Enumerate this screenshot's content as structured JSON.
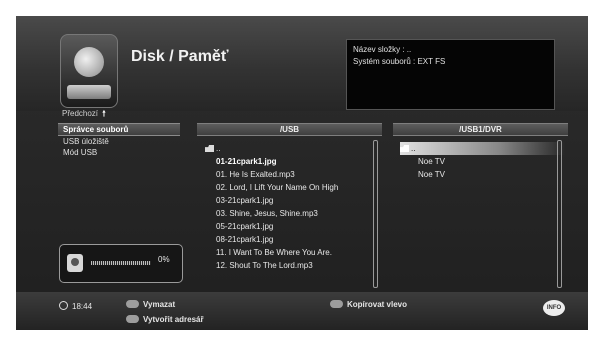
{
  "header": {
    "title": "Disk / Paměť",
    "info_folder": "Název složky : ..",
    "info_fs": "Systém souborů : EXT FS"
  },
  "sidebar": {
    "previous_label": "Předchozí",
    "previous_arrow": "🠕",
    "items": [
      {
        "label": "Správce souborů",
        "selected": true
      },
      {
        "label": "USB úložiště",
        "selected": false
      },
      {
        "label": "Mód USB",
        "selected": false
      }
    ],
    "usage_percent_label": "0%",
    "usage_fraction": 0
  },
  "left_pane": {
    "header": "/USB",
    "files": [
      "..",
      "01-21cpark1.jpg",
      "01. He Is Exalted.mp3",
      "02. Lord, I Lift Your Name On High",
      "03-21cpark1.jpg",
      "03. Shine, Jesus, Shine.mp3",
      "05-21cpark1.jpg",
      "08-21cpark1.jpg",
      "11. I Want To Be Where You Are.",
      "12. Shout To The Lord.mp3"
    ]
  },
  "right_pane": {
    "header": "/USB1/DVR",
    "files": [
      "..",
      "Noe TV",
      "Noe TV"
    ]
  },
  "footer": {
    "time": "18:44",
    "delete_label": "Vymazat",
    "make_dir_label": "Vytvořit adresář",
    "copy_left_label": "Kopírovat vlevo",
    "info_label": "INFO"
  },
  "colors": {
    "background": "#262626",
    "highlight": "#e6e6e6",
    "panel": "#050505"
  }
}
